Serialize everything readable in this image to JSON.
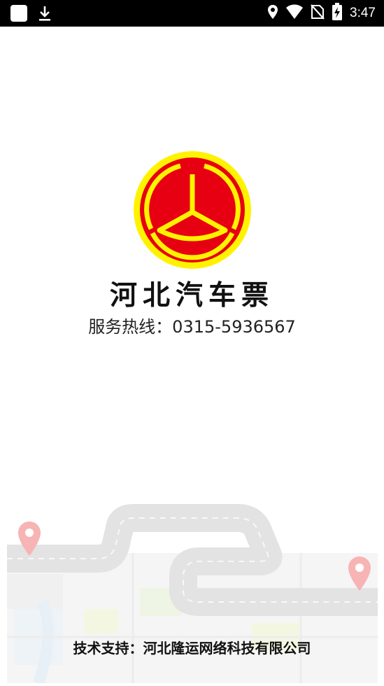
{
  "status_bar": {
    "time": "3:47",
    "icons": [
      "app-square-icon",
      "download-icon",
      "location-icon",
      "wifi-icon",
      "no-sim-icon",
      "battery-charging-icon"
    ]
  },
  "app": {
    "title": "河北汽车票",
    "hotline": "服务热线：0315-5936567",
    "support": "技术支持：河北隆运网络科技有限公司"
  },
  "colors": {
    "logo_yellow": "#FFF200",
    "logo_red": "#E60012",
    "status_bar_bg": "#000000",
    "background": "#FFFFFF",
    "pin_red": "#F25C5C"
  }
}
